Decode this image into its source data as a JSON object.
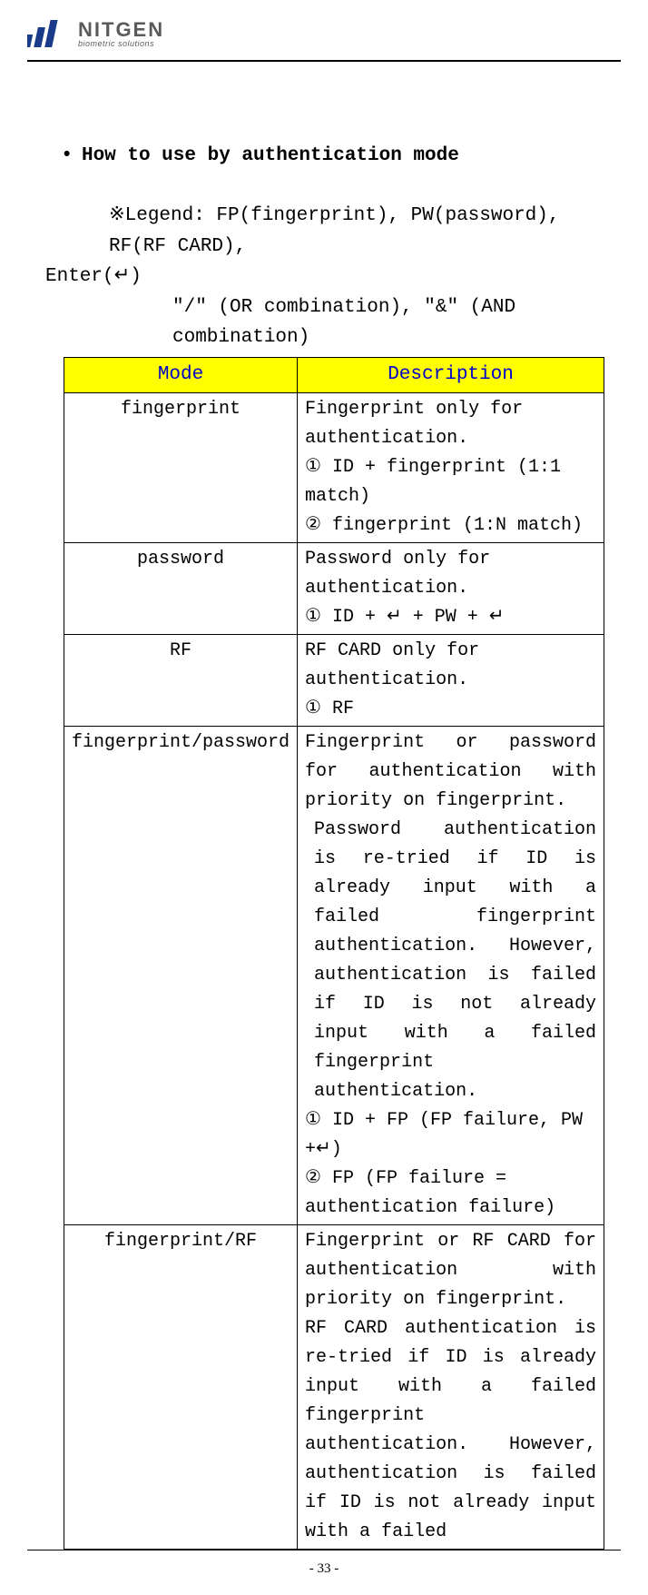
{
  "logo": {
    "main": "NITGEN",
    "sub": "biometric solutions"
  },
  "heading_bullet": "•",
  "heading": "How to use by authentication mode",
  "legend": {
    "mark": "※",
    "line1a": "Legend: FP(fingerprint), PW(password), RF(RF CARD),",
    "line1b": "Enter(↵)",
    "line2": "\"/\" (OR combination), \"&\" (AND combination)"
  },
  "table": {
    "header": {
      "mode": "Mode",
      "desc": "Description"
    },
    "rows": [
      {
        "mode": "fingerprint",
        "desc_lines": [
          "Fingerprint only for authentication.",
          "① ID + fingerprint (1:1 match)",
          "② fingerprint (1:N match)"
        ]
      },
      {
        "mode": "password",
        "desc_lines": [
          "Password only for authentication.",
          "① ID + ↵ + PW + ↵"
        ]
      },
      {
        "mode": "RF",
        "desc_lines": [
          "RF CARD only for authentication.",
          "① RF"
        ]
      },
      {
        "mode": "fingerprint/password",
        "desc_lines": [
          "Fingerprint or password for authentication with priority on fingerprint.",
          "Password authentication is re-tried if ID is already input with a failed fingerprint authentication. However, authentication is failed if ID is not already input with a failed fingerprint authentication.",
          "① ID + FP (FP failure, PW +↵)",
          "② FP (FP failure = authentication failure)"
        ]
      },
      {
        "mode": "fingerprint/RF",
        "desc_lines": [
          "Fingerprint or RF CARD for authentication with priority on fingerprint.",
          "RF CARD authentication is re-tried if ID is already input with a failed fingerprint authentication. However, authentication is failed if ID is not already input with a failed"
        ]
      }
    ]
  },
  "page_number": "- 33 -"
}
